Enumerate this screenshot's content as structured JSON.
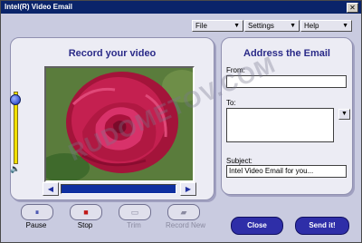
{
  "window": {
    "title": "Intel(R) Video Email",
    "close_glyph": "✕"
  },
  "menu": {
    "items": [
      {
        "label": "File"
      },
      {
        "label": "Settings"
      },
      {
        "label": "Help"
      }
    ],
    "arrow_glyph": "▼"
  },
  "record_panel": {
    "title": "Record your video",
    "speaker_glyph": "🔈",
    "seek_back_glyph": "◀",
    "seek_forward_glyph": "▶",
    "volume_level": 0.9,
    "controls": [
      {
        "label": "Pause",
        "icon": "pause-icon",
        "glyph": "⏸",
        "enabled": true
      },
      {
        "label": "Stop",
        "icon": "stop-icon",
        "glyph": "■",
        "enabled": true
      },
      {
        "label": "Trim",
        "icon": "film-icon",
        "glyph": "▭",
        "enabled": false
      },
      {
        "label": "Record New",
        "icon": "camera-icon",
        "glyph": "▰",
        "enabled": false
      }
    ]
  },
  "address_panel": {
    "title": "Address the Email",
    "from_label": "From:",
    "from_value": "",
    "to_label": "To:",
    "to_value": "",
    "dropdown_glyph": "▼",
    "subject_label": "Subject:",
    "subject_value": "Intel Video Email for you..."
  },
  "actions": {
    "close_label": "Close",
    "send_label": "Send it!"
  },
  "watermark": "RUDOMETOV.COM",
  "colors": {
    "title_bar": "#0a246a",
    "accent": "#2e2ea8",
    "panel_title": "#2a2a88",
    "seek_bar": "#1030a0",
    "volume": "#f0e000"
  }
}
